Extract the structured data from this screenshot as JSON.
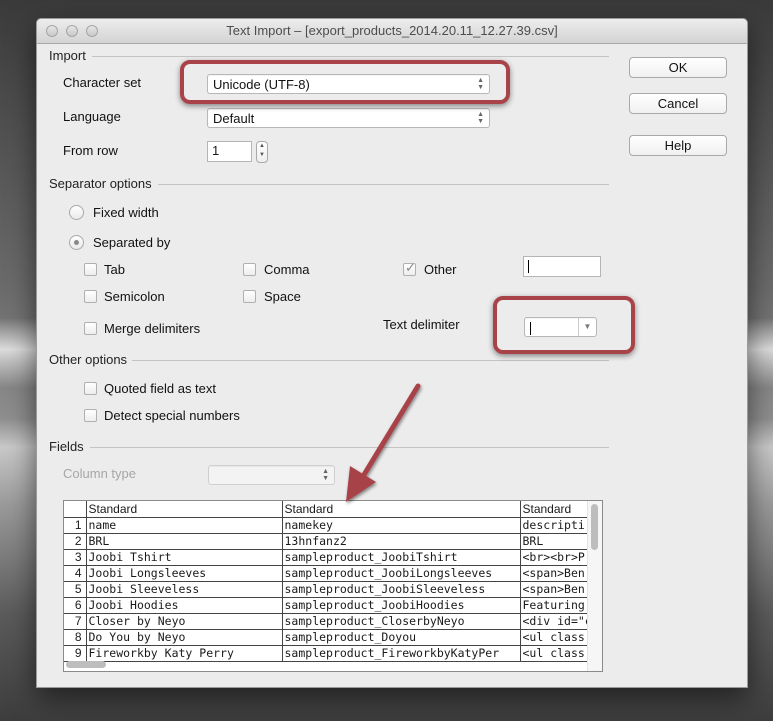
{
  "window": {
    "title": "Text Import – [export_products_2014.20.11_12.27.39.csv]"
  },
  "buttons": {
    "ok": "OK",
    "cancel": "Cancel",
    "help": "Help"
  },
  "import": {
    "section_label": "Import",
    "character_set_label": "Character set",
    "character_set_value": "Unicode (UTF-8)",
    "language_label": "Language",
    "language_value": "Default",
    "from_row_label": "From row",
    "from_row_value": "1"
  },
  "separator": {
    "section_label": "Separator options",
    "fixed_width_label": "Fixed width",
    "separated_by_label": "Separated by",
    "selected_mode": "separated_by",
    "tab_label": "Tab",
    "comma_label": "Comma",
    "other_label": "Other",
    "other_checked": true,
    "semicolon_label": "Semicolon",
    "space_label": "Space",
    "merge_label": "Merge delimiters",
    "text_delimiter_label": "Text delimiter"
  },
  "other_options": {
    "section_label": "Other options",
    "quoted_label": "Quoted field as text",
    "detect_label": "Detect special numbers"
  },
  "fields": {
    "section_label": "Fields",
    "column_type_label": "Column type",
    "columns": [
      "Standard",
      "Standard",
      "Standard"
    ],
    "rows": [
      {
        "n": "1",
        "c1": "name",
        "c2": "namekey",
        "c3": "descripti"
      },
      {
        "n": "2",
        "c1": "BRL",
        "c2": "13hnfanz2",
        "c3": "BRL"
      },
      {
        "n": "3",
        "c1": "Joobi Tshirt",
        "c2": "sampleproduct_JoobiTshirt",
        "c3": "<br><br>P"
      },
      {
        "n": "4",
        "c1": "Joobi Longsleeves",
        "c2": "sampleproduct_JoobiLongsleeves",
        "c3": "<span>Ben"
      },
      {
        "n": "5",
        "c1": "Joobi Sleeveless",
        "c2": "sampleproduct_JoobiSleeveless",
        "c3": "<span>Ben"
      },
      {
        "n": "6",
        "c1": "Joobi Hoodies",
        "c2": "sampleproduct_JoobiHoodies",
        "c3": "Featuring"
      },
      {
        "n": "7",
        "c1": "Closer by Neyo",
        "c2": "sampleproduct_CloserbyNeyo",
        "c3": "<div id=\"c"
      },
      {
        "n": "8",
        "c1": "Do You by Neyo",
        "c2": "sampleproduct_Doyou",
        "c3": "<ul class"
      },
      {
        "n": "9",
        "c1": "Fireworkby Katy Perry",
        "c2": "sampleproduct_FireworkbyKatyPer",
        "c3": "<ul class"
      }
    ]
  },
  "colors": {
    "highlight": "#a8434a"
  }
}
